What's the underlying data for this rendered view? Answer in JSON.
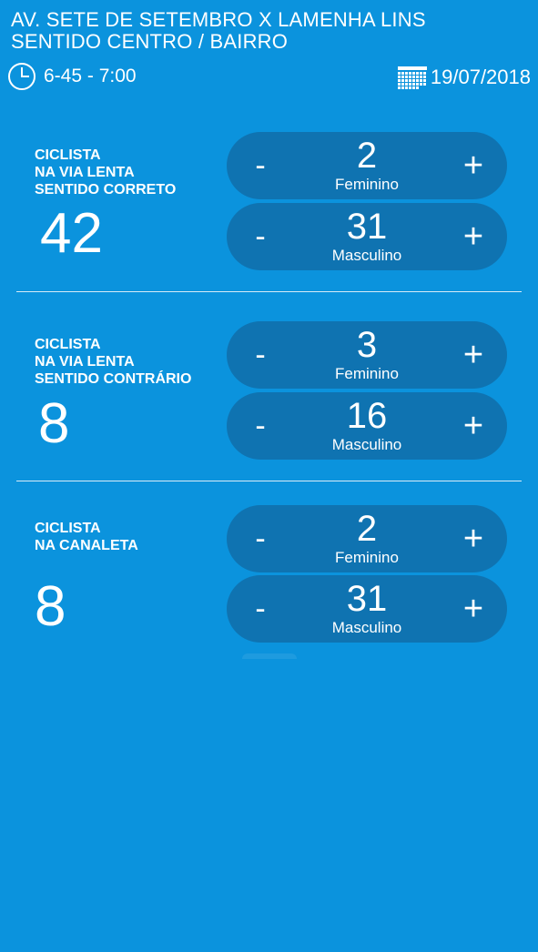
{
  "header": {
    "title_line1": "AV. SETE DE SETEMBRO X LAMENHA LINS",
    "title_line2": "SENTIDO CENTRO / BAIRRO",
    "time_icon": "clock-icon",
    "time_range": "6-45 - 7:00",
    "date_icon": "calendar-icon",
    "date": "19/07/2018"
  },
  "sections": [
    {
      "label_lines": [
        "CICLISTA",
        "NA VIA LENTA",
        "SENTIDO CORRETO"
      ],
      "total": "42",
      "female": {
        "value": "2",
        "label": "Feminino"
      },
      "male": {
        "value": "31",
        "label": "Masculino"
      }
    },
    {
      "label_lines": [
        "CICLISTA",
        "NA VIA LENTA",
        "SENTIDO CONTRÁRIO"
      ],
      "total": "8",
      "female": {
        "value": "3",
        "label": "Feminino"
      },
      "male": {
        "value": "16",
        "label": "Masculino"
      }
    },
    {
      "label_lines": [
        "CICLISTA",
        "NA CANALETA"
      ],
      "total": "8",
      "female": {
        "value": "2",
        "label": "Feminino"
      },
      "male": {
        "value": "31",
        "label": "Masculino"
      }
    }
  ],
  "controls": {
    "minus": "-",
    "plus": "+"
  },
  "colors": {
    "background": "#0b93dd",
    "counter_pill": "#0f73b1",
    "text": "#ffffff"
  }
}
